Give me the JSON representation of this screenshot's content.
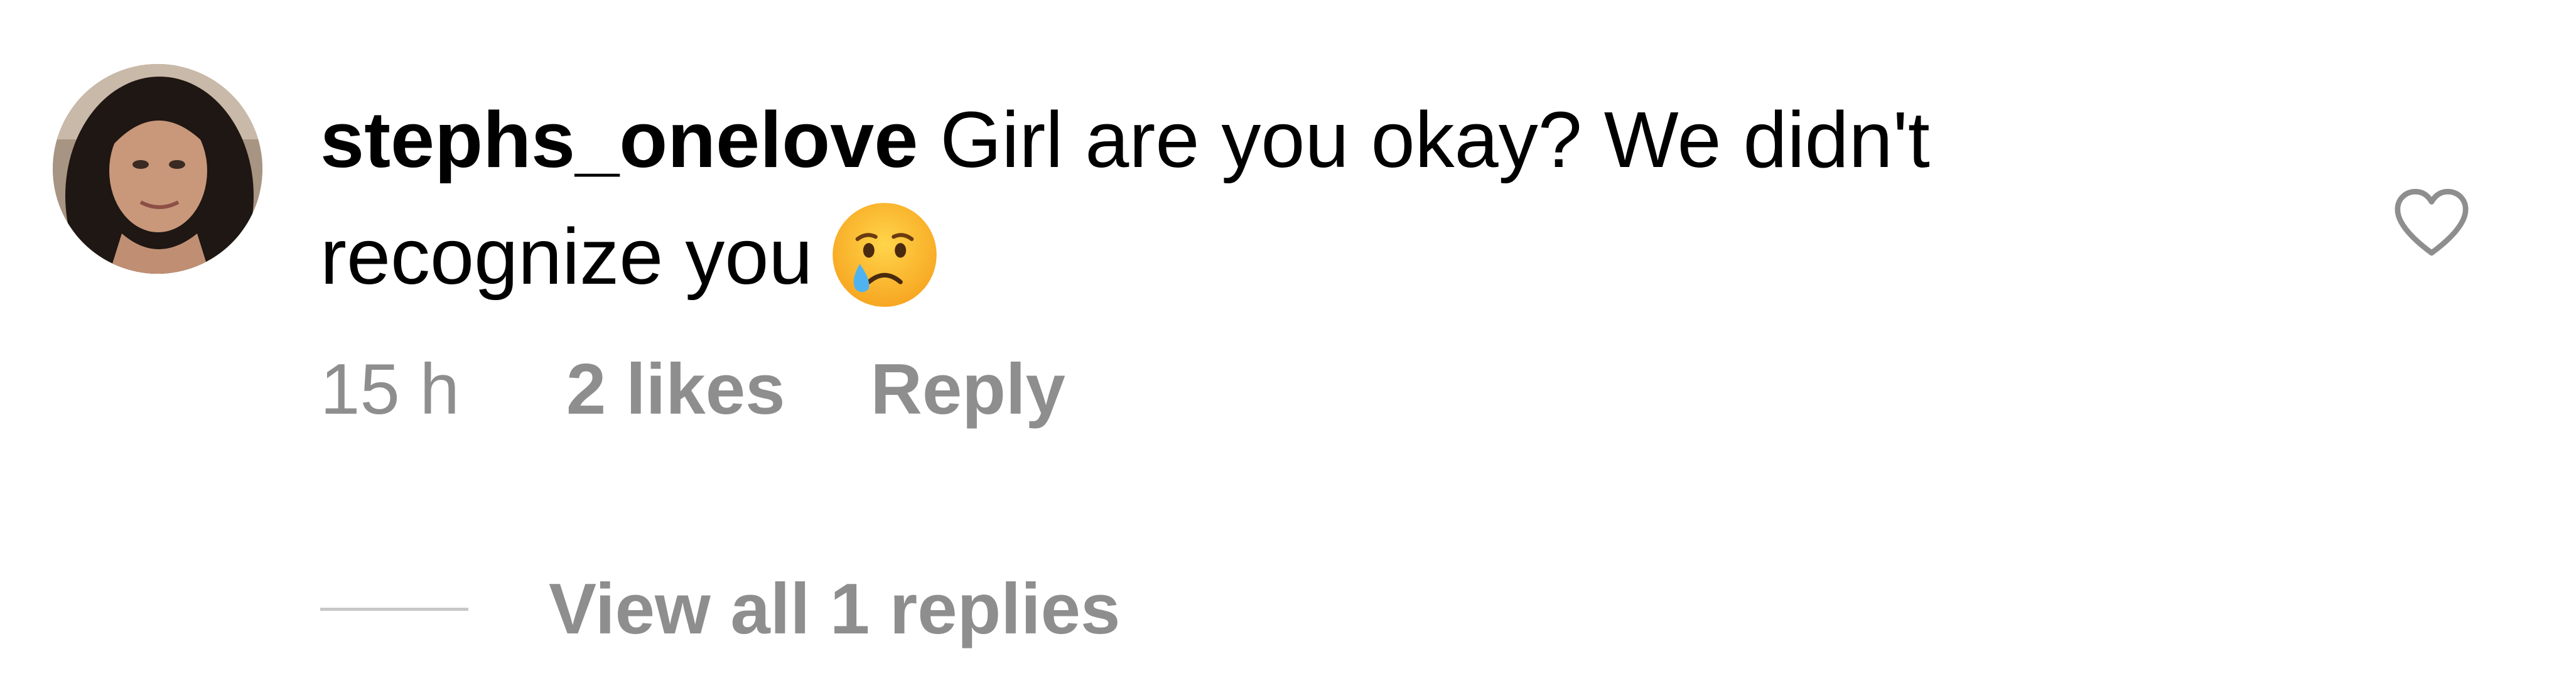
{
  "comment": {
    "username": "stephs_onelove",
    "text": "Girl are you okay? We didn't recognize you",
    "emoji_icon": "crying-face-icon",
    "timestamp": "15 h",
    "likes": "2 likes",
    "reply_label": "Reply",
    "like_icon": "heart-outline-icon"
  },
  "replies": {
    "view_all_label": "View all 1 replies"
  },
  "colors": {
    "text": "#000000",
    "meta": "#8e8e8e",
    "divider": "#c7c7c7",
    "background": "#ffffff"
  }
}
